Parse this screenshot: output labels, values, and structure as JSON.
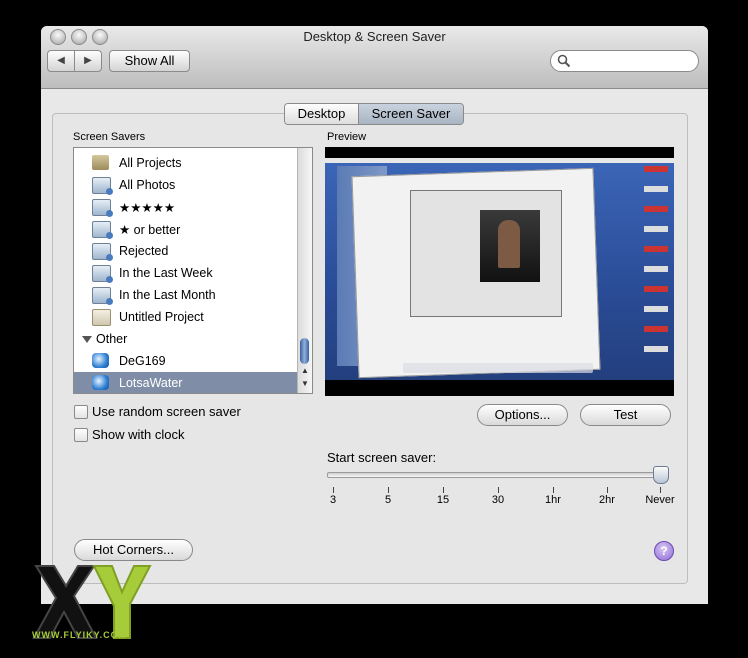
{
  "window": {
    "title": "Desktop & Screen Saver"
  },
  "toolbar": {
    "back_glyph": "◀",
    "forward_glyph": "▶",
    "show_all_label": "Show All",
    "search_placeholder": "",
    "search_value": ""
  },
  "tabs": [
    {
      "label": "Desktop",
      "selected": false
    },
    {
      "label": "Screen Saver",
      "selected": true
    }
  ],
  "screen_savers": {
    "heading": "Screen Savers",
    "items": [
      {
        "label": "All Projects",
        "icon": "folder-icon"
      },
      {
        "label": "All Photos",
        "icon": "photo-album-icon"
      },
      {
        "label": "★★★★★",
        "icon": "photo-album-icon"
      },
      {
        "label": "★ or better",
        "icon": "photo-album-icon"
      },
      {
        "label": "Rejected",
        "icon": "photo-album-icon"
      },
      {
        "label": "In the Last Week",
        "icon": "photo-album-icon"
      },
      {
        "label": "In the Last Month",
        "icon": "photo-album-icon"
      },
      {
        "label": "Untitled Project",
        "icon": "project-icon"
      }
    ],
    "group_other": "Other",
    "other_items": [
      {
        "label": "DeG169",
        "icon": "swirl-icon",
        "selected": false
      },
      {
        "label": "LotsaWater",
        "icon": "swirl-icon",
        "selected": true
      }
    ]
  },
  "preview": {
    "heading": "Preview"
  },
  "options": {
    "random_label": "Use random screen saver",
    "random_checked": false,
    "clock_label": "Show with clock",
    "clock_checked": false,
    "options_button": "Options...",
    "test_button": "Test"
  },
  "start": {
    "label": "Start screen saver:",
    "ticks": [
      "3",
      "5",
      "15",
      "30",
      "1hr",
      "2hr",
      "Never"
    ],
    "selected": "Never"
  },
  "hot_corners_label": "Hot Corners...",
  "help_label": "?",
  "watermark": {
    "logo_text": "XY",
    "url": "WWW.FLYIKY.COM"
  }
}
